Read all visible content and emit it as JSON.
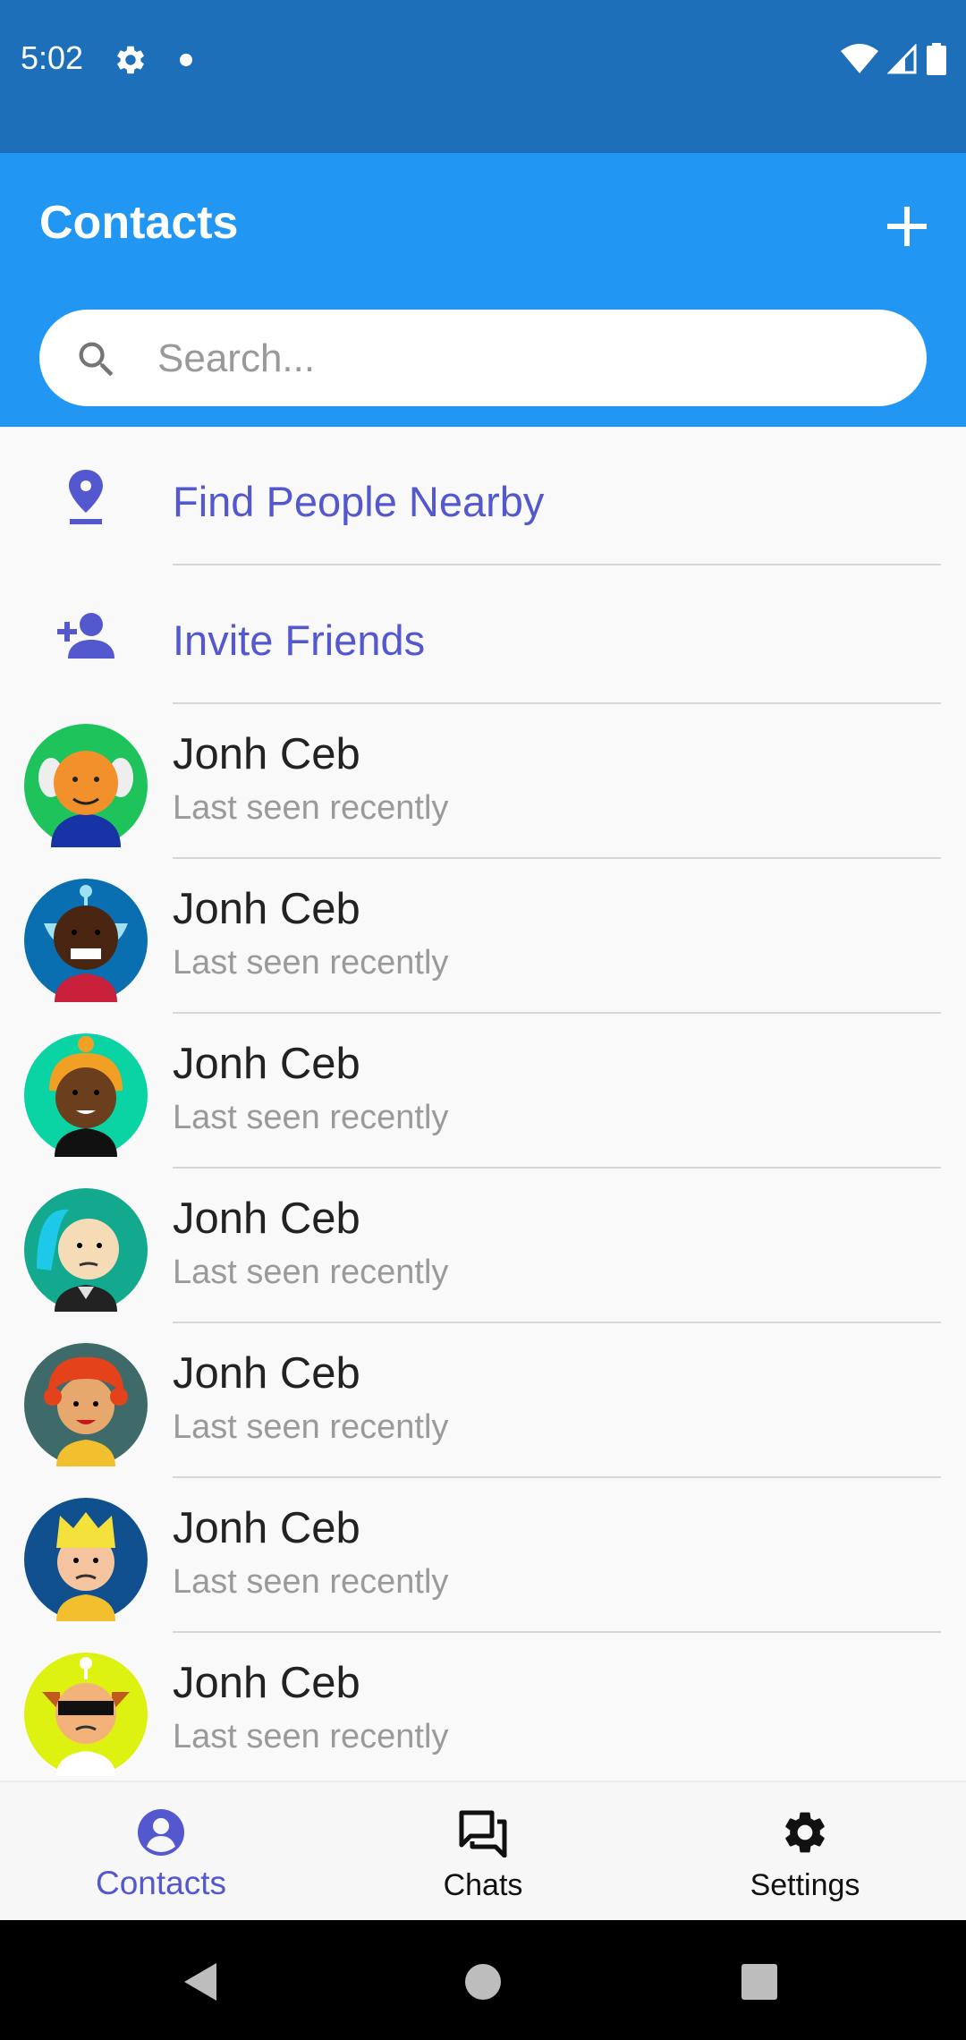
{
  "status_bar": {
    "time": "5:02"
  },
  "app_bar": {
    "title": "Contacts"
  },
  "search": {
    "placeholder": "Search..."
  },
  "actions": [
    {
      "label": "Find People Nearby",
      "icon": "location-pin-icon"
    },
    {
      "label": "Invite Friends",
      "icon": "add-person-icon"
    }
  ],
  "contacts": [
    {
      "name": "Jonh Ceb",
      "status": "Last seen recently"
    },
    {
      "name": "Jonh Ceb",
      "status": "Last seen recently"
    },
    {
      "name": "Jonh Ceb",
      "status": "Last seen recently"
    },
    {
      "name": "Jonh Ceb",
      "status": "Last seen recently"
    },
    {
      "name": "Jonh Ceb",
      "status": "Last seen recently"
    },
    {
      "name": "Jonh Ceb",
      "status": "Last seen recently"
    },
    {
      "name": "Jonh Ceb",
      "status": "Last seen recently"
    }
  ],
  "bottom_nav": [
    {
      "label": "Contacts",
      "icon": "person-icon",
      "active": true
    },
    {
      "label": "Chats",
      "icon": "chats-icon",
      "active": false
    },
    {
      "label": "Settings",
      "icon": "gear-icon",
      "active": false
    }
  ],
  "colors": {
    "status_bar": "#1c6fb8",
    "app_bar": "#2196f3",
    "accent": "#5458cf",
    "avatar_backgrounds": [
      "#1fc35b",
      "#0a6fb0",
      "#0bd4a4",
      "#12a98e",
      "#3f6a6a",
      "#11508e",
      "#ddf211"
    ]
  }
}
